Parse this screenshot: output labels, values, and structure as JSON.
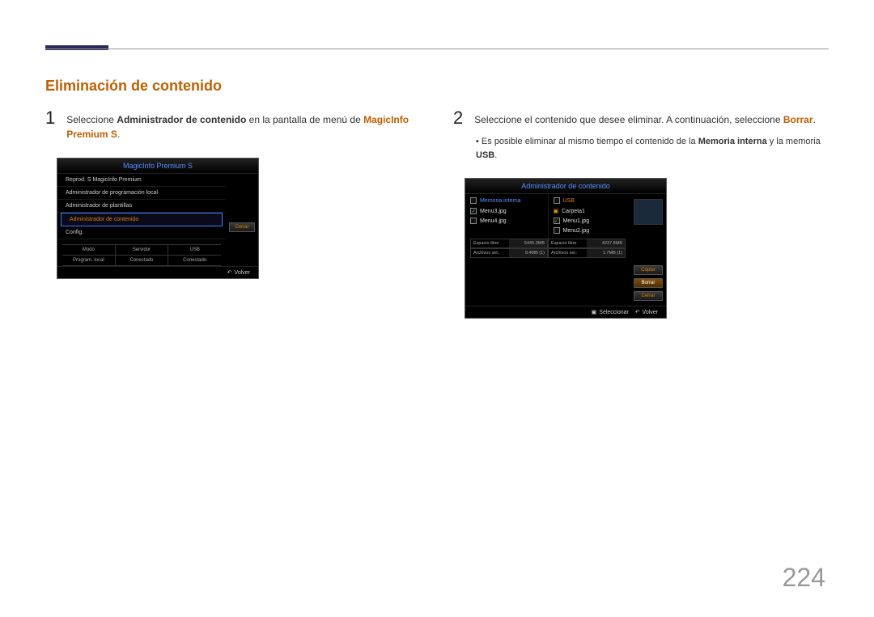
{
  "section_title": "Eliminación de contenido",
  "page_number": "224",
  "step1": {
    "num": "1",
    "pre": "Seleccione ",
    "bold": "Administrador de contenido",
    "mid": " en la pantalla de menú de ",
    "accent": "MagicInfo Premium S",
    "post": "."
  },
  "step2": {
    "num": "2",
    "pre": "Seleccione el contenido que desee eliminar. A continuación, seleccione ",
    "accent": "Borrar",
    "post": "."
  },
  "bullet": {
    "pre": "Es posible eliminar al mismo tiempo el contenido de la ",
    "bold1": "Memoria interna",
    "mid": " y la memoria ",
    "bold2": "USB",
    "post": "."
  },
  "panel1": {
    "title": "MagicInfo Premium S",
    "items": [
      "Reprod. S MagicInfo Premium",
      "Administrador de programación local",
      "Administrador de plantillas",
      "Administrador de contenido",
      "Config."
    ],
    "side_btn": "Cerrar",
    "grid_h": [
      "Modo",
      "Servidor",
      "USB"
    ],
    "grid_v": [
      "Program. local",
      "Conectado",
      "Conectado"
    ],
    "footer_return": "Volver"
  },
  "panel2": {
    "title": "Administrador de contenido",
    "col1": {
      "head": "Memoria interna",
      "files": [
        {
          "checked": true,
          "name": "Menu3.jpg"
        },
        {
          "checked": false,
          "name": "Menu4.jpg"
        }
      ],
      "free_label": "Espacio libre",
      "free_val": "5445.3MB",
      "sel_label": "Archivos sel.:",
      "sel_val": "9.4MB (1)"
    },
    "col2": {
      "head": "USB",
      "folder": "Carpeta1",
      "files": [
        {
          "checked": true,
          "name": "Menu1.jpg"
        },
        {
          "checked": false,
          "name": "Menu2.jpg"
        }
      ],
      "free_label": "Espacio libre",
      "free_val": "4237.8MB",
      "sel_label": "Archivos sel.:",
      "sel_val": "1.7MB (1)"
    },
    "side": {
      "copy": "Copiar",
      "delete": "Borrar",
      "close": "Cerrar"
    },
    "footer_select": "Seleccionar",
    "footer_return": "Volver"
  }
}
